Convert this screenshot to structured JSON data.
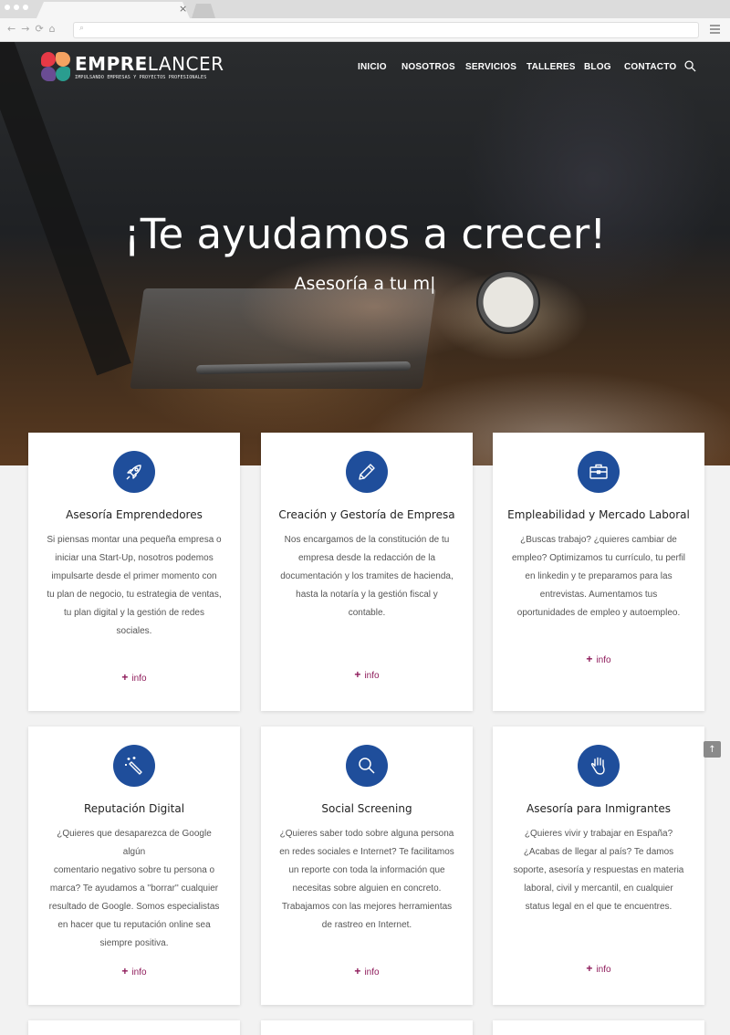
{
  "browser": {
    "tab_close": "×",
    "nav_back": "←",
    "nav_forward": "→",
    "nav_reload": "⟳",
    "nav_home": "⌂",
    "url_search_glyph": "⌕"
  },
  "header": {
    "logo_bold": "EMPRE",
    "logo_light": "LANCER",
    "tagline": "IMPULSANDO EMPRESAS Y PROYECTOS PROFESIONALES",
    "nav": [
      "INICIO",
      "NOSOTROS",
      "SERVICIOS",
      "TALLERES",
      "BLOG",
      "CONTACTO"
    ],
    "logo_colors": [
      "#e63946",
      "#f4a261",
      "#2a9d8f",
      "#6a4c93"
    ]
  },
  "hero": {
    "title": "¡Te ayudamos a crecer!",
    "subtitle": "Asesoría a tu m|"
  },
  "cards": [
    {
      "icon": "rocket-icon",
      "title": "Asesoría Emprendedores",
      "lines": [
        "Si piensas montar una pequeña empresa o",
        "iniciar una Start-Up, nosotros podemos",
        "impulsarte desde el primer momento con",
        "tu plan de negocio, tu estrategia de ventas,",
        "tu plan digital y la gestión de redes",
        "sociales."
      ],
      "info": "info"
    },
    {
      "icon": "pencil-icon",
      "title": "Creación y Gestoría de Empresa",
      "lines": [
        "Nos encargamos de la constitución de tu",
        "empresa desde la redacción de la",
        "documentación y los tramites de hacienda,",
        "hasta la notaría y la gestión fiscal y",
        "contable."
      ],
      "info": "info"
    },
    {
      "icon": "briefcase-icon",
      "title": "Empleabilidad y Mercado Laboral",
      "lines": [
        "¿Buscas trabajo? ¿quieres cambiar de",
        "empleo? Optimizamos tu currículo, tu perfil",
        "en linkedin y te preparamos para las",
        "entrevistas. Aumentamos tus",
        "oportunidades de empleo y autoempleo."
      ],
      "info": "info"
    },
    {
      "icon": "magic-wand-icon",
      "title": "Reputación Digital",
      "lines": [
        "¿Quieres que desaparezca de Google algún",
        "comentario negativo sobre tu persona o",
        "marca? Te ayudamos a ''borrar'' cualquier",
        "resultado de Google. Somos especialistas",
        "en hacer que tu reputación online sea",
        "siempre positiva."
      ],
      "info": "info"
    },
    {
      "icon": "magnifier-icon",
      "title": "Social Screening",
      "lines": [
        "¿Quieres saber todo sobre alguna persona",
        "en redes sociales e Internet? Te facilitamos",
        "un reporte con toda la información que",
        "necesitas sobre alguien en concreto.",
        "Trabajamos con las mejores herramientas",
        "de rastreo en Internet."
      ],
      "info": "info"
    },
    {
      "icon": "hand-icon",
      "title": "Asesoría para Inmigrantes",
      "lines": [
        "¿Quieres vivir y trabajar en España?",
        "¿Acabas de llegar al país? Te damos",
        "soporte, asesoría y respuestas en materia",
        "laboral, civil y mercantil, en cualquier",
        "status legal en el que te encuentres."
      ],
      "info": "info"
    }
  ],
  "colors": {
    "icon_circle": "#1f4e9b",
    "info_link": "#8e1a5a"
  },
  "scroll_top_glyph": "↑"
}
